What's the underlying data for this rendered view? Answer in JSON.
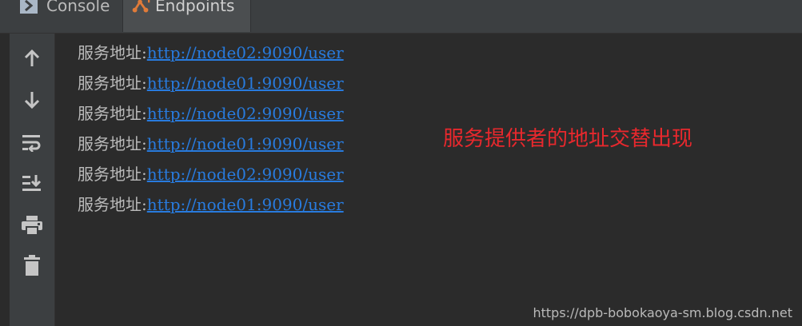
{
  "tabs": [
    {
      "label": "Console",
      "icon": "console-icon"
    },
    {
      "label": "Endpoints",
      "icon": "endpoints-icon"
    }
  ],
  "toolbar": {
    "icons": [
      "arrow-up-icon",
      "arrow-down-icon",
      "soft-wrap-icon",
      "scroll-to-end-icon",
      "print-icon",
      "trash-icon"
    ]
  },
  "console": {
    "lines": [
      {
        "prefix": "服务地址:",
        "url": "http://node02:9090/user"
      },
      {
        "prefix": "服务地址:",
        "url": "http://node01:9090/user"
      },
      {
        "prefix": "服务地址:",
        "url": "http://node02:9090/user"
      },
      {
        "prefix": "服务地址:",
        "url": "http://node01:9090/user"
      },
      {
        "prefix": "服务地址:",
        "url": "http://node02:9090/user"
      },
      {
        "prefix": "服务地址:",
        "url": "http://node01:9090/user"
      }
    ]
  },
  "annotation": "服务提供者的地址交替出现",
  "watermark": "https://dpb-bobokaoya-sm.blog.csdn.net",
  "colors": {
    "background": "#2b2b2b",
    "panel": "#3c3f41",
    "link": "#287bde",
    "annotation": "#e8282d",
    "text": "#bbbbbb"
  }
}
